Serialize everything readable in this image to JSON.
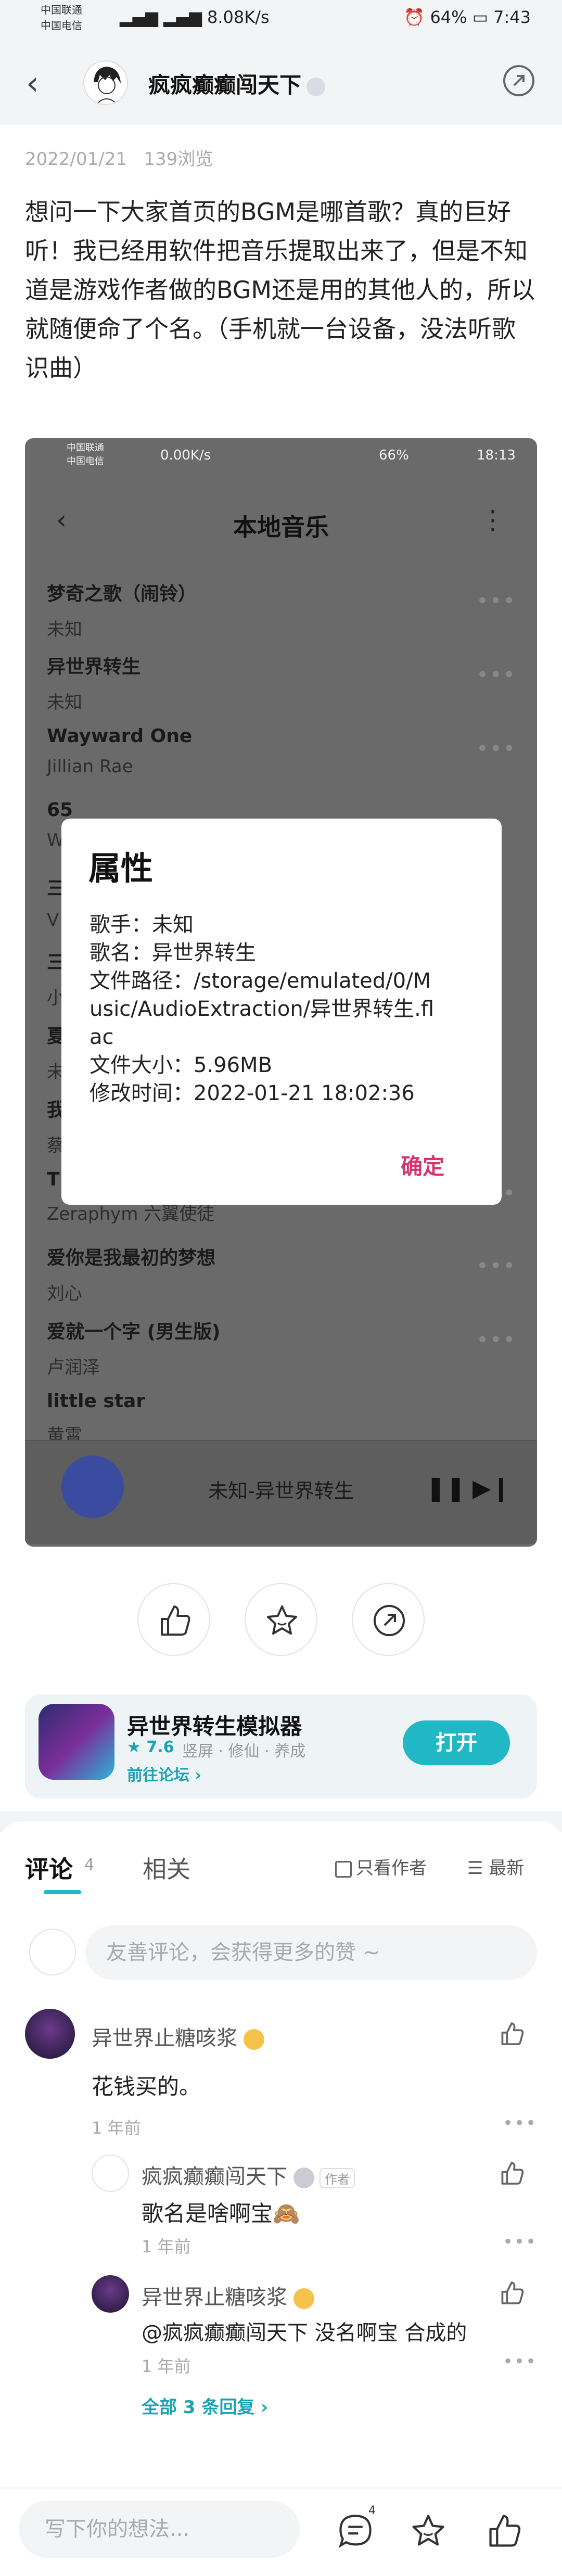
{
  "status_bar": {
    "carrier1": "中国联通",
    "carrier2": "中国电信",
    "speed": "8.08K/s",
    "battery": "64%",
    "time": "7:43"
  },
  "header": {
    "username": "疯疯癫癫闯天下"
  },
  "post": {
    "date": "2022/01/21",
    "views": "139浏览",
    "text": "想问一下大家首页的BGM是哪首歌？真的巨好听！我已经用软件把音乐提取出来了，但是不知道是游戏作者做的BGM还是用的其他人的，所以就随便命了个名。（手机就一台设备，没法听歌识曲）"
  },
  "screenshot": {
    "status": {
      "carrier1": "中国联通",
      "carrier2": "中国电信",
      "speed": "0.00K/s",
      "battery": "66%",
      "time": "18:13"
    },
    "title": "本地音乐",
    "songs": [
      {
        "title": "梦奇之歌（闹铃）",
        "artist": "未知"
      },
      {
        "title": "异世界转生",
        "artist": "未知"
      },
      {
        "title": "Wayward One",
        "artist": "Jillian Rae"
      },
      {
        "title": "65",
        "artist": "W"
      },
      {
        "title": "三",
        "artist": "V"
      },
      {
        "title": "三",
        "artist": "小"
      },
      {
        "title": "夏",
        "artist": "未"
      },
      {
        "title": "我",
        "artist": "蔡"
      },
      {
        "title": "T",
        "artist": "Zeraphym 六翼使徒"
      },
      {
        "title": "爱你是我最初的梦想",
        "artist": "刘心"
      },
      {
        "title": "爱就一个字 (男生版)",
        "artist": "卢润泽"
      },
      {
        "title": "little star",
        "artist": "黄霄"
      }
    ],
    "player_title": "未知-异世界转生",
    "dialog": {
      "title": "属性",
      "singer": "歌手：未知",
      "song_name": "歌名：异世界转生",
      "path": "文件路径：/storage/emulated/0/Music/AudioExtraction/异世界转生.flac",
      "size": "文件大小：5.96MB",
      "modified": "修改时间：2022-01-21 18:02:36",
      "ok": "确定"
    }
  },
  "game": {
    "name": "异世界转生模拟器",
    "rating": "★ 7.6",
    "tags": "竖屏 · 修仙 · 养成",
    "forum_link": "前往论坛 ›",
    "open_label": "打开"
  },
  "comments_section": {
    "tab_comments": "评论",
    "comment_count": "4",
    "tab_related": "相关",
    "only_author": "只看作者",
    "sort_latest": "最新",
    "input_placeholder": "友善评论，会获得更多的赞 ~",
    "comments": [
      {
        "user": "异世界止糖咳浆",
        "text": "花钱买的。",
        "time": "1 年前"
      }
    ],
    "replies": [
      {
        "user": "疯疯癫癫闯天下",
        "tag": "作者",
        "text": "歌名是啥啊宝🙈",
        "time": "1 年前"
      },
      {
        "user": "异世界止糖咳浆",
        "text": "@疯疯癫癫闯天下  没名啊宝 合成的",
        "time": "1 年前"
      }
    ],
    "all_replies": "全部 3 条回复 ›"
  },
  "bottom_bar": {
    "input_placeholder": "写下你的想法...",
    "comment_badge": "4"
  },
  "colors": {
    "accent": "#1fb8c4",
    "confirm": "#d6336c",
    "background": "#f3f4f5"
  }
}
